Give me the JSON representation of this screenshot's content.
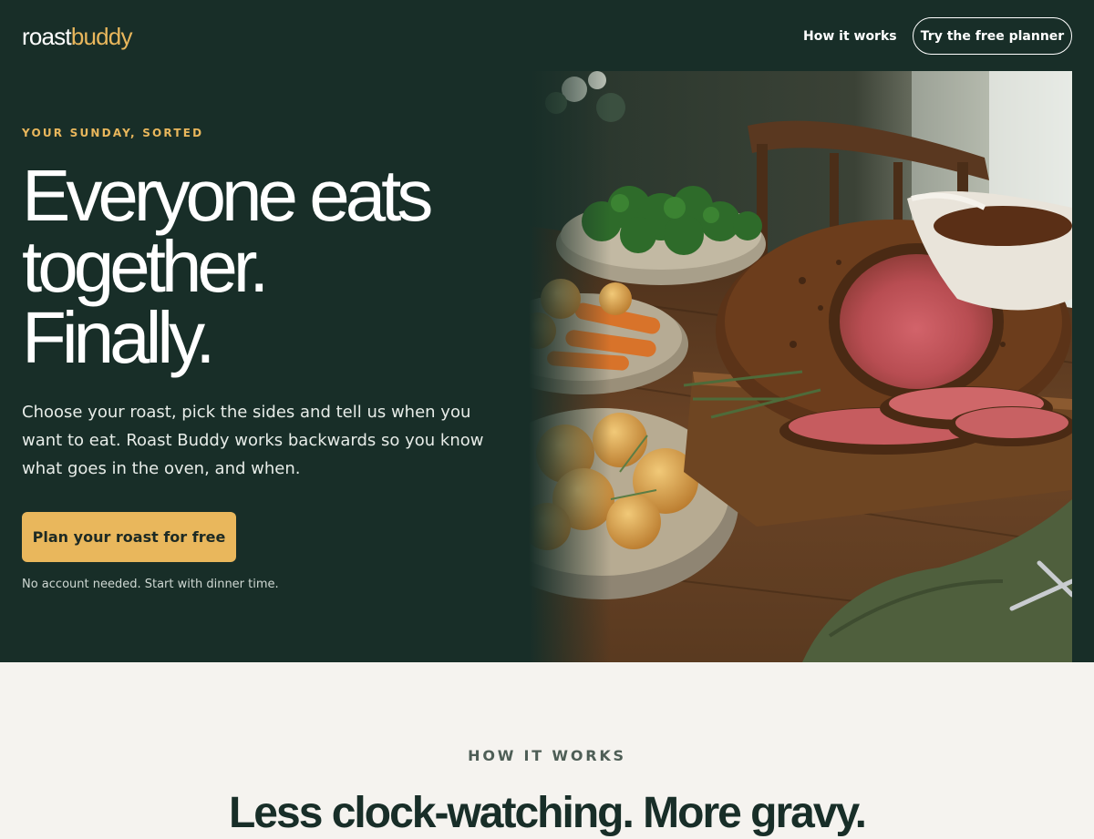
{
  "brand": {
    "part1": "roast",
    "part2": "buddy"
  },
  "nav": {
    "link": "How it works",
    "cta": "Try the free planner"
  },
  "hero": {
    "eyebrow": "YOUR SUNDAY, SORTED",
    "headline": [
      "Everyone eats",
      "together.",
      "Finally."
    ],
    "lead": "Choose your roast, pick the sides and tell us when you want to eat. Roast Buddy works backwards so you know what goes in the oven, and when.",
    "cta": "Plan your roast for free",
    "note": "No account needed. Start with dinner time."
  },
  "how_it_works": {
    "eyebrow": "HOW IT WORKS",
    "title": "Less clock-watching. More gravy."
  },
  "colors": {
    "hero_bg": "#182e28",
    "accent": "#e9b75c",
    "page_bg": "#f5f3ef",
    "text_dark": "#182e28"
  },
  "icons": [
    "roast-dinner-photo"
  ]
}
